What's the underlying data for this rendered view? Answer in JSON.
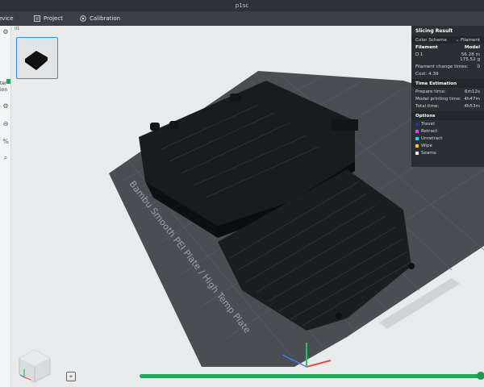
{
  "window": {
    "title": "p1sc"
  },
  "tabs": [
    {
      "label": "evice",
      "icon": "device-icon"
    },
    {
      "label": "Project",
      "icon": "project-icon"
    },
    {
      "label": "Calibration",
      "icon": "calibration-icon"
    }
  ],
  "left_panel": {
    "line1": "ter",
    "line2": "ion"
  },
  "thumbnail": {
    "id": "01"
  },
  "plate": {
    "label": "Bambu Smooth PEI Plate / High Temp Plate"
  },
  "slicing_result": {
    "title": "Slicing Result",
    "color_scheme_label": "Color Scheme",
    "color_scheme_value": "Filament",
    "filament_header": "Filament",
    "model_header": "Model",
    "filament_index": "1",
    "filament_length": "56.28 m",
    "filament_weight": "175.52 g",
    "change_times_label": "Filament change times:",
    "change_times_value": "0",
    "cost_label": "Cost:",
    "cost_value": "4.39",
    "time_section": "Time Estimation",
    "prepare_label": "Prepare time:",
    "prepare_value": "6m12s",
    "model_time_label": "Model printing time:",
    "model_time_value": "4h47m",
    "total_label": "Total time:",
    "total_value": "4h53m",
    "options_section": "Options",
    "options": [
      {
        "label": "Travel",
        "color": "#1e3a8a"
      },
      {
        "label": "Retract",
        "color": "#d946ef"
      },
      {
        "label": "Unretract",
        "color": "#22d3ee"
      },
      {
        "label": "Wipe",
        "color": "#facc15"
      },
      {
        "label": "Seams",
        "color": "#f3f4f6"
      }
    ]
  },
  "layer_slider": {
    "progress": 1.0
  },
  "colors": {
    "accent": "#2d8ee6",
    "slider": "#26a65b",
    "panel": "#2b2e33"
  }
}
